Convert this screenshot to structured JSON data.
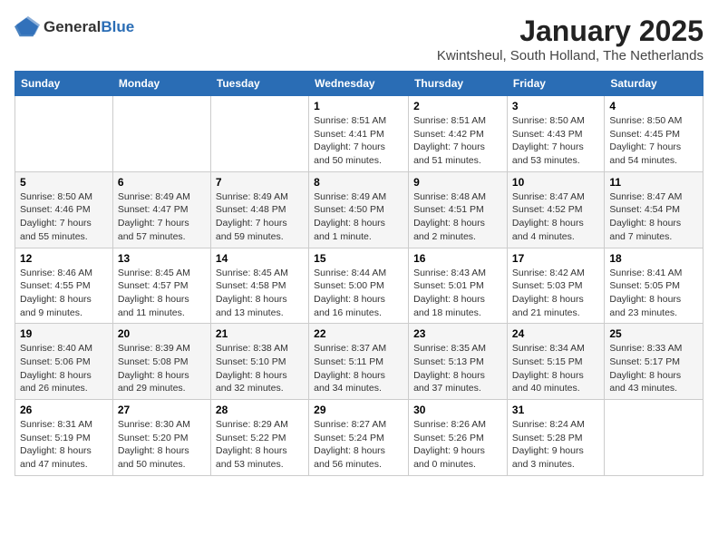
{
  "header": {
    "logo_general": "General",
    "logo_blue": "Blue",
    "month_title": "January 2025",
    "location": "Kwintsheul, South Holland, The Netherlands"
  },
  "days_of_week": [
    "Sunday",
    "Monday",
    "Tuesday",
    "Wednesday",
    "Thursday",
    "Friday",
    "Saturday"
  ],
  "weeks": [
    [
      {
        "day": "",
        "info": ""
      },
      {
        "day": "",
        "info": ""
      },
      {
        "day": "",
        "info": ""
      },
      {
        "day": "1",
        "info": "Sunrise: 8:51 AM\nSunset: 4:41 PM\nDaylight: 7 hours and 50 minutes."
      },
      {
        "day": "2",
        "info": "Sunrise: 8:51 AM\nSunset: 4:42 PM\nDaylight: 7 hours and 51 minutes."
      },
      {
        "day": "3",
        "info": "Sunrise: 8:50 AM\nSunset: 4:43 PM\nDaylight: 7 hours and 53 minutes."
      },
      {
        "day": "4",
        "info": "Sunrise: 8:50 AM\nSunset: 4:45 PM\nDaylight: 7 hours and 54 minutes."
      }
    ],
    [
      {
        "day": "5",
        "info": "Sunrise: 8:50 AM\nSunset: 4:46 PM\nDaylight: 7 hours and 55 minutes."
      },
      {
        "day": "6",
        "info": "Sunrise: 8:49 AM\nSunset: 4:47 PM\nDaylight: 7 hours and 57 minutes."
      },
      {
        "day": "7",
        "info": "Sunrise: 8:49 AM\nSunset: 4:48 PM\nDaylight: 7 hours and 59 minutes."
      },
      {
        "day": "8",
        "info": "Sunrise: 8:49 AM\nSunset: 4:50 PM\nDaylight: 8 hours and 1 minute."
      },
      {
        "day": "9",
        "info": "Sunrise: 8:48 AM\nSunset: 4:51 PM\nDaylight: 8 hours and 2 minutes."
      },
      {
        "day": "10",
        "info": "Sunrise: 8:47 AM\nSunset: 4:52 PM\nDaylight: 8 hours and 4 minutes."
      },
      {
        "day": "11",
        "info": "Sunrise: 8:47 AM\nSunset: 4:54 PM\nDaylight: 8 hours and 7 minutes."
      }
    ],
    [
      {
        "day": "12",
        "info": "Sunrise: 8:46 AM\nSunset: 4:55 PM\nDaylight: 8 hours and 9 minutes."
      },
      {
        "day": "13",
        "info": "Sunrise: 8:45 AM\nSunset: 4:57 PM\nDaylight: 8 hours and 11 minutes."
      },
      {
        "day": "14",
        "info": "Sunrise: 8:45 AM\nSunset: 4:58 PM\nDaylight: 8 hours and 13 minutes."
      },
      {
        "day": "15",
        "info": "Sunrise: 8:44 AM\nSunset: 5:00 PM\nDaylight: 8 hours and 16 minutes."
      },
      {
        "day": "16",
        "info": "Sunrise: 8:43 AM\nSunset: 5:01 PM\nDaylight: 8 hours and 18 minutes."
      },
      {
        "day": "17",
        "info": "Sunrise: 8:42 AM\nSunset: 5:03 PM\nDaylight: 8 hours and 21 minutes."
      },
      {
        "day": "18",
        "info": "Sunrise: 8:41 AM\nSunset: 5:05 PM\nDaylight: 8 hours and 23 minutes."
      }
    ],
    [
      {
        "day": "19",
        "info": "Sunrise: 8:40 AM\nSunset: 5:06 PM\nDaylight: 8 hours and 26 minutes."
      },
      {
        "day": "20",
        "info": "Sunrise: 8:39 AM\nSunset: 5:08 PM\nDaylight: 8 hours and 29 minutes."
      },
      {
        "day": "21",
        "info": "Sunrise: 8:38 AM\nSunset: 5:10 PM\nDaylight: 8 hours and 32 minutes."
      },
      {
        "day": "22",
        "info": "Sunrise: 8:37 AM\nSunset: 5:11 PM\nDaylight: 8 hours and 34 minutes."
      },
      {
        "day": "23",
        "info": "Sunrise: 8:35 AM\nSunset: 5:13 PM\nDaylight: 8 hours and 37 minutes."
      },
      {
        "day": "24",
        "info": "Sunrise: 8:34 AM\nSunset: 5:15 PM\nDaylight: 8 hours and 40 minutes."
      },
      {
        "day": "25",
        "info": "Sunrise: 8:33 AM\nSunset: 5:17 PM\nDaylight: 8 hours and 43 minutes."
      }
    ],
    [
      {
        "day": "26",
        "info": "Sunrise: 8:31 AM\nSunset: 5:19 PM\nDaylight: 8 hours and 47 minutes."
      },
      {
        "day": "27",
        "info": "Sunrise: 8:30 AM\nSunset: 5:20 PM\nDaylight: 8 hours and 50 minutes."
      },
      {
        "day": "28",
        "info": "Sunrise: 8:29 AM\nSunset: 5:22 PM\nDaylight: 8 hours and 53 minutes."
      },
      {
        "day": "29",
        "info": "Sunrise: 8:27 AM\nSunset: 5:24 PM\nDaylight: 8 hours and 56 minutes."
      },
      {
        "day": "30",
        "info": "Sunrise: 8:26 AM\nSunset: 5:26 PM\nDaylight: 9 hours and 0 minutes."
      },
      {
        "day": "31",
        "info": "Sunrise: 8:24 AM\nSunset: 5:28 PM\nDaylight: 9 hours and 3 minutes."
      },
      {
        "day": "",
        "info": ""
      }
    ]
  ]
}
